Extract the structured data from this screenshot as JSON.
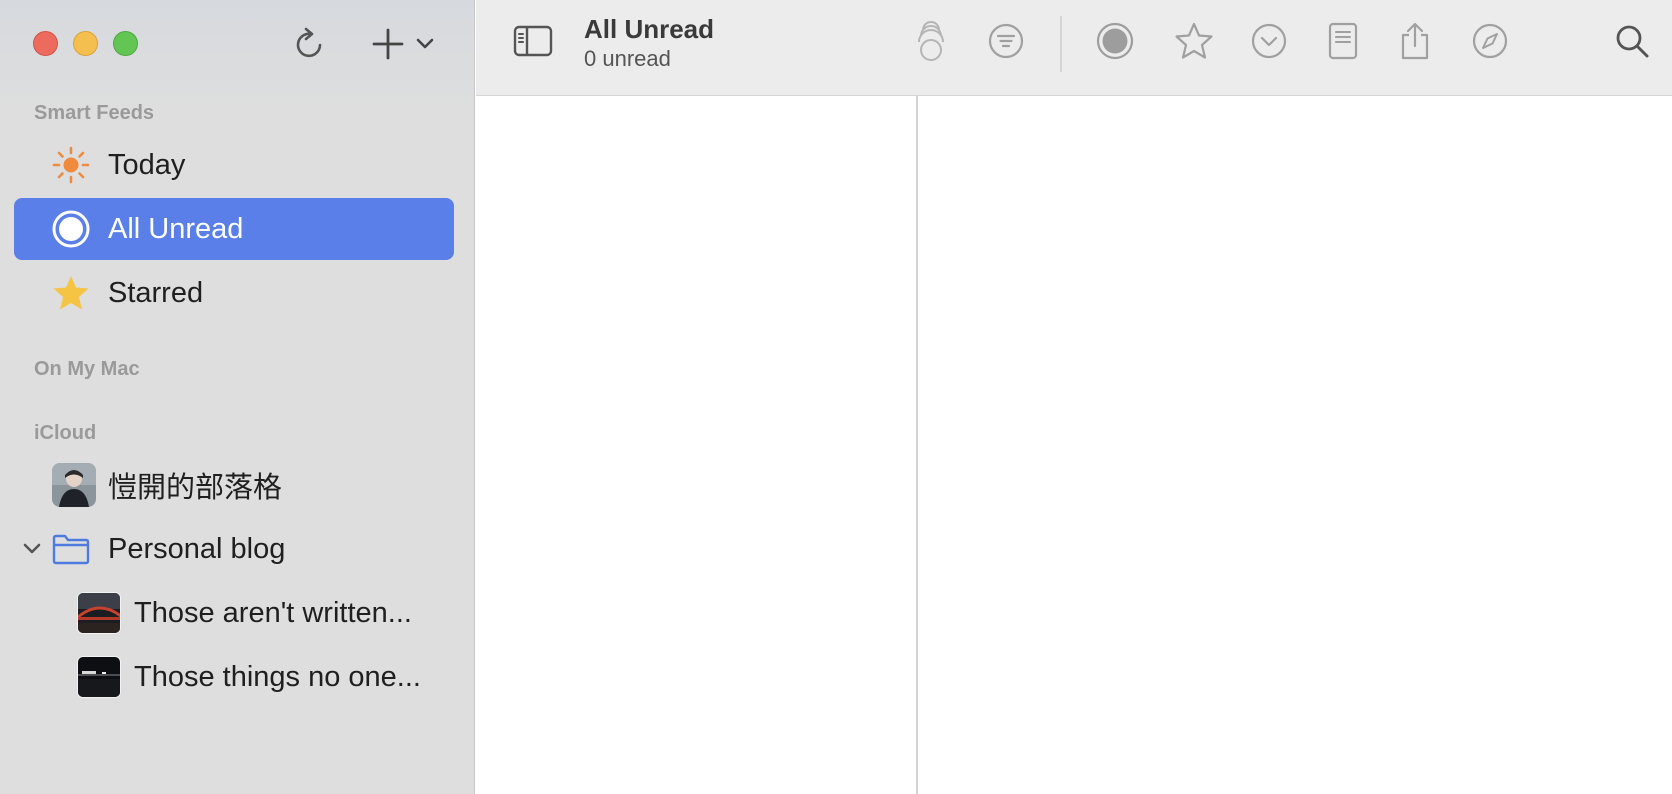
{
  "window": {
    "sidebar_actions": [
      "refresh-icon",
      "plus-icon",
      "chevron-down-icon"
    ]
  },
  "sidebar": {
    "smart_feeds_header": "Smart Feeds",
    "smart_feeds": [
      {
        "label": "Today",
        "icon": "sun-icon"
      },
      {
        "label": "All Unread",
        "icon": "unread-circle-icon",
        "selected": true
      },
      {
        "label": "Starred",
        "icon": "star-icon"
      }
    ],
    "on_my_mac_header": "On My Mac",
    "icloud_header": "iCloud",
    "icloud_feeds": [
      {
        "label": "愷開的部落格",
        "icon": "avatar"
      }
    ],
    "folder": {
      "label": "Personal blog",
      "expanded": true,
      "children": [
        {
          "label": "Those aren't written..."
        },
        {
          "label": "Those things no one..."
        }
      ]
    }
  },
  "toolbar": {
    "title": "All Unread",
    "subtitle": "0 unread",
    "icons": [
      "sidebar-toggle-icon",
      "mark-all-read-icon",
      "filter-icon",
      "mark-read-icon",
      "star-icon",
      "next-unread-icon",
      "reader-view-icon",
      "share-icon",
      "open-in-browser-icon",
      "search-icon"
    ]
  },
  "colors": {
    "selection": "#5a7fe8",
    "sun": "#f08a3c",
    "star": "#f5c445",
    "folder": "#4f7be0"
  }
}
